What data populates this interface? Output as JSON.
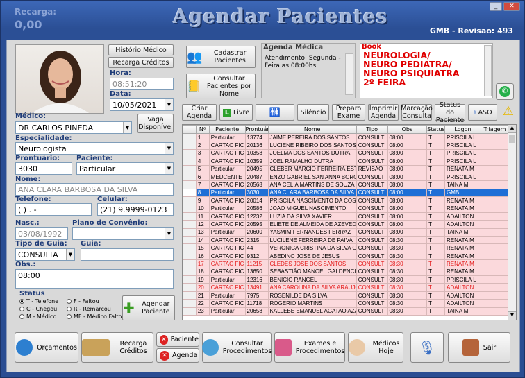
{
  "header": {
    "recarga_label": "Recarga:",
    "recarga_value": "0,00",
    "title": "Agendar Pacientes",
    "revision": "GMB - Revisão: 493"
  },
  "left": {
    "btn_historico": "Histório Médico",
    "btn_recarga": "Recarga Créditos",
    "hora_label": "Hora:",
    "hora_value": "08:51:20",
    "data_label": "Data:",
    "data_value": "10/05/2021",
    "medico_label": "Médico:",
    "medico_value": "DR CARLOS PINEDA",
    "vaga_btn": "Vaga Disponível",
    "especialidade_label": "Especialidade:",
    "especialidade_value": "Neurologista",
    "prontuario_label": "Prontuário:",
    "prontuario_value": "3030",
    "paciente_label": "Paciente:",
    "paciente_value": "Particular",
    "nome_label": "Nome:",
    "nome_value": "ANA CLARA BARBOSA DA SILVA",
    "telefone_label": "Telefone:",
    "telefone_value": "( )  .  -",
    "celular_label": "Celular:",
    "celular_value": "(21) 9.9999-0123",
    "nasc_label": "Nasc.:",
    "nasc_value": "03/08/1992",
    "plano_label": "Plano de Convênio:",
    "tipo_guia_label": "Tipo de Guia:",
    "tipo_guia_value": "CONSULTA",
    "guia_label": "Guia:",
    "obs_label": "Obs.:",
    "obs_value": "08:00",
    "status_title": "Status",
    "status_options": [
      "T - Telefone",
      "F - Faltou",
      "C - Chegou",
      "R - Remarcou",
      "M - Médico",
      "MF - Médico Faltou"
    ],
    "agendar_btn": "Agendar Paciente"
  },
  "top": {
    "cadastrar_btn": "Cadastrar Pacientes",
    "consultar_btn": "Consultar Pacientes por Nome",
    "agenda_title": "Agenda Médica",
    "agenda_text": "Atendimento: Segunda - Feira as 08:00hs",
    "book_title": "Book",
    "book_lines": [
      "NEUROLOGIA/",
      "NEURO PEDIATRA/",
      "NEURO PSIQUIATRA",
      "2º FEIRA"
    ]
  },
  "toolbar": {
    "criar": "Criar Agenda",
    "livre": "Livre",
    "silencio": "Silêncio",
    "preparo": "Preparo Exame",
    "imprimir": "Imprimir Agenda",
    "marcacao": "Marcação Consulta",
    "status": "Status do Paciente",
    "aso": "ASO"
  },
  "grid": {
    "columns": [
      "Nº",
      "Paciente",
      "Prontuário",
      "Nome",
      "Tipo",
      "Obs",
      "Status",
      "Logon",
      "Triagem"
    ],
    "rows": [
      [
        "1",
        "Particular",
        "13774",
        "JAIME PEREIRA DOS SANTOS",
        "CONSULT",
        "08:00",
        "T",
        "PRISCILA L"
      ],
      [
        "2",
        "CARTAO FIC",
        "20136",
        "LUCIENE RIBEIRO DOS SANTOS TEIXEIRA",
        "CONSULT",
        "08:00",
        "T",
        "PRISCILA L"
      ],
      [
        "3",
        "CARTAO FIC",
        "10358",
        "JOELMA DOS SANTOS DUTRA",
        "CONSULT",
        "08:00",
        "T",
        "PRISCILA L"
      ],
      [
        "4",
        "CARTAO FIC",
        "10359",
        "JOEL RAMALHO DUTRA",
        "CONSULT",
        "08:00",
        "T",
        "PRISCILA L"
      ],
      [
        "5",
        "Particular",
        "20495",
        "CLEBER MARCIO FERREIRA ESTRELA",
        "REVISÃO",
        "08:00",
        "T",
        "RENATA M"
      ],
      [
        "6",
        "MEDCENTE",
        "20487",
        "ENZO GABRIEL SAN ANNA BORGES",
        "CONSULT",
        "08:00",
        "T",
        "PRISCILA L"
      ],
      [
        "7",
        "CARTAO FIC",
        "20568",
        "ANA CELIA MARTINS DE SOUZA",
        "CONSULT",
        "08:00",
        "T",
        "TAINA M"
      ],
      [
        "8",
        "Particular",
        "3030",
        "ANA CLARA BARBOSA DA SILVA",
        "CONSULT",
        "08:00",
        "T",
        "GMB"
      ],
      [
        "9",
        "CARTAO FIC",
        "20014",
        "PRISCILA NASCIMENTO DA COSTA",
        "CONSULT",
        "08:00",
        "T",
        "RENATA M"
      ],
      [
        "10",
        "Particular",
        "20586",
        "JOAO MIGUEL NASCIMENTO",
        "CONSULT",
        "08:00",
        "T",
        "RENATA M"
      ],
      [
        "11",
        "CARTAO FIC",
        "12232",
        "LUZIA DA SILVA XAVIER",
        "CONSULT",
        "08:00",
        "T",
        "ADAILTON"
      ],
      [
        "12",
        "CARTAO FIC",
        "20595",
        "ELIETE DE ALMEIDA DE AZEVEDO",
        "CONSULT",
        "08:00",
        "T",
        "ADAILTON"
      ],
      [
        "13",
        "Particular",
        "20600",
        "YASMIM FERNANDES FERRAZ",
        "CONSULT",
        "08:00",
        "T",
        "TAINA M"
      ],
      [
        "14",
        "CARTAO FIC",
        "2315",
        "LUCILENE FERREIRA DE PAIVA",
        "CONSULT",
        "08:30",
        "T",
        "RENATA M"
      ],
      [
        "15",
        "CARTAO FIC",
        "44",
        "VERONICA CRISTINA DA SILVA GOMES",
        "CONSULT",
        "08:30",
        "T",
        "RENATA M"
      ],
      [
        "16",
        "CARTAO FIC",
        "9312",
        "ABEDINO JOSE DE JESUS",
        "CONSULT",
        "08:30",
        "T",
        "RENATA M"
      ],
      [
        "17",
        "CARTAO FIC",
        "11215",
        "CLEDES JOSE DOS SANTOS",
        "CONSULT",
        "08:30",
        "T",
        "RENATA M"
      ],
      [
        "18",
        "CARTAO FIC",
        "13650",
        "SEBASTIÃO MANOEL GALDENCIO",
        "CONSULT",
        "08:30",
        "T",
        "RENATA M"
      ],
      [
        "19",
        "Particular",
        "12316",
        "BENICIO RANGEL",
        "CONSULT",
        "08:30",
        "T",
        "PRISCILA L"
      ],
      [
        "20",
        "CARTAO FIC",
        "13491",
        "ANA CAROLINA DA SILVA ARAUJO",
        "CONSULT",
        "08:30",
        "T",
        "ADAILTON"
      ],
      [
        "21",
        "Particular",
        "7975",
        "ROSENILDE DA SILVA",
        "CONSULT",
        "08:30",
        "T",
        "ADAILTON"
      ],
      [
        "22",
        "CARTAO FIC",
        "11718",
        "ROGERIO MARTINS",
        "CONSULT",
        "08:30",
        "T",
        "ADAILTON"
      ],
      [
        "23",
        "Particular",
        "20658",
        "KALLEBE EMANUEL AGATAO AZANA",
        "CONSULT",
        "08:30",
        "T",
        "TAINA M"
      ]
    ],
    "selected_row": 7,
    "red_rows": [
      16,
      19
    ]
  },
  "bottom": {
    "orcamentos": "Orçamentos",
    "recarga": "Recarga Créditos",
    "paciente": "Paciente",
    "agenda": "Agenda",
    "consultar_proc": "Consultar Procedimentos",
    "exames": "Exames e Procedimentos",
    "medicos": "Médicos Hoje",
    "sair": "Sair"
  },
  "colors": {
    "accent": "#1e6fd6",
    "row": "#fbd9dc",
    "book_red": "#e00000",
    "label_blue": "#1f3c78"
  }
}
